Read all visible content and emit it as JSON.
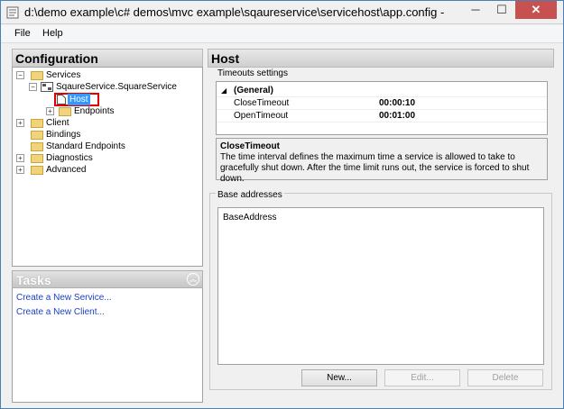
{
  "window": {
    "title": "d:\\demo example\\c# demos\\mvc example\\sqaureservice\\servicehost\\app.config - Microsof...",
    "minimize": "─",
    "maximize": "☐",
    "close": "✕"
  },
  "menu": {
    "file": "File",
    "help": "Help"
  },
  "configuration": {
    "header": "Configuration",
    "tree": {
      "services": "Services",
      "service_name": "SqaureService.SquareService",
      "host": "Host",
      "endpoints": "Endpoints",
      "client": "Client",
      "bindings": "Bindings",
      "standard_endpoints": "Standard Endpoints",
      "diagnostics": "Diagnostics",
      "advanced": "Advanced"
    }
  },
  "tasks": {
    "header": "Tasks",
    "collapse": "︽",
    "links": [
      "Create a New Service...",
      "Create a New Client..."
    ]
  },
  "host": {
    "header": "Host",
    "timeouts_label": "Timeouts settings",
    "category": "(General)",
    "rows": [
      {
        "name": "CloseTimeout",
        "value": "00:00:10"
      },
      {
        "name": "OpenTimeout",
        "value": "00:01:00"
      }
    ],
    "description_title": "CloseTimeout",
    "description_text": "The time interval defines the maximum time a service is allowed to take to gracefully shut down. After the time limit runs out, the service is forced to shut down.",
    "base_addresses_label": "Base addresses",
    "base_address_column": "BaseAddress",
    "buttons": {
      "new": "New...",
      "edit": "Edit...",
      "delete": "Delete"
    }
  },
  "colors": {
    "accent": "#1c3fc4",
    "selection": "#3399ff",
    "highlight_box": "#e00000"
  }
}
